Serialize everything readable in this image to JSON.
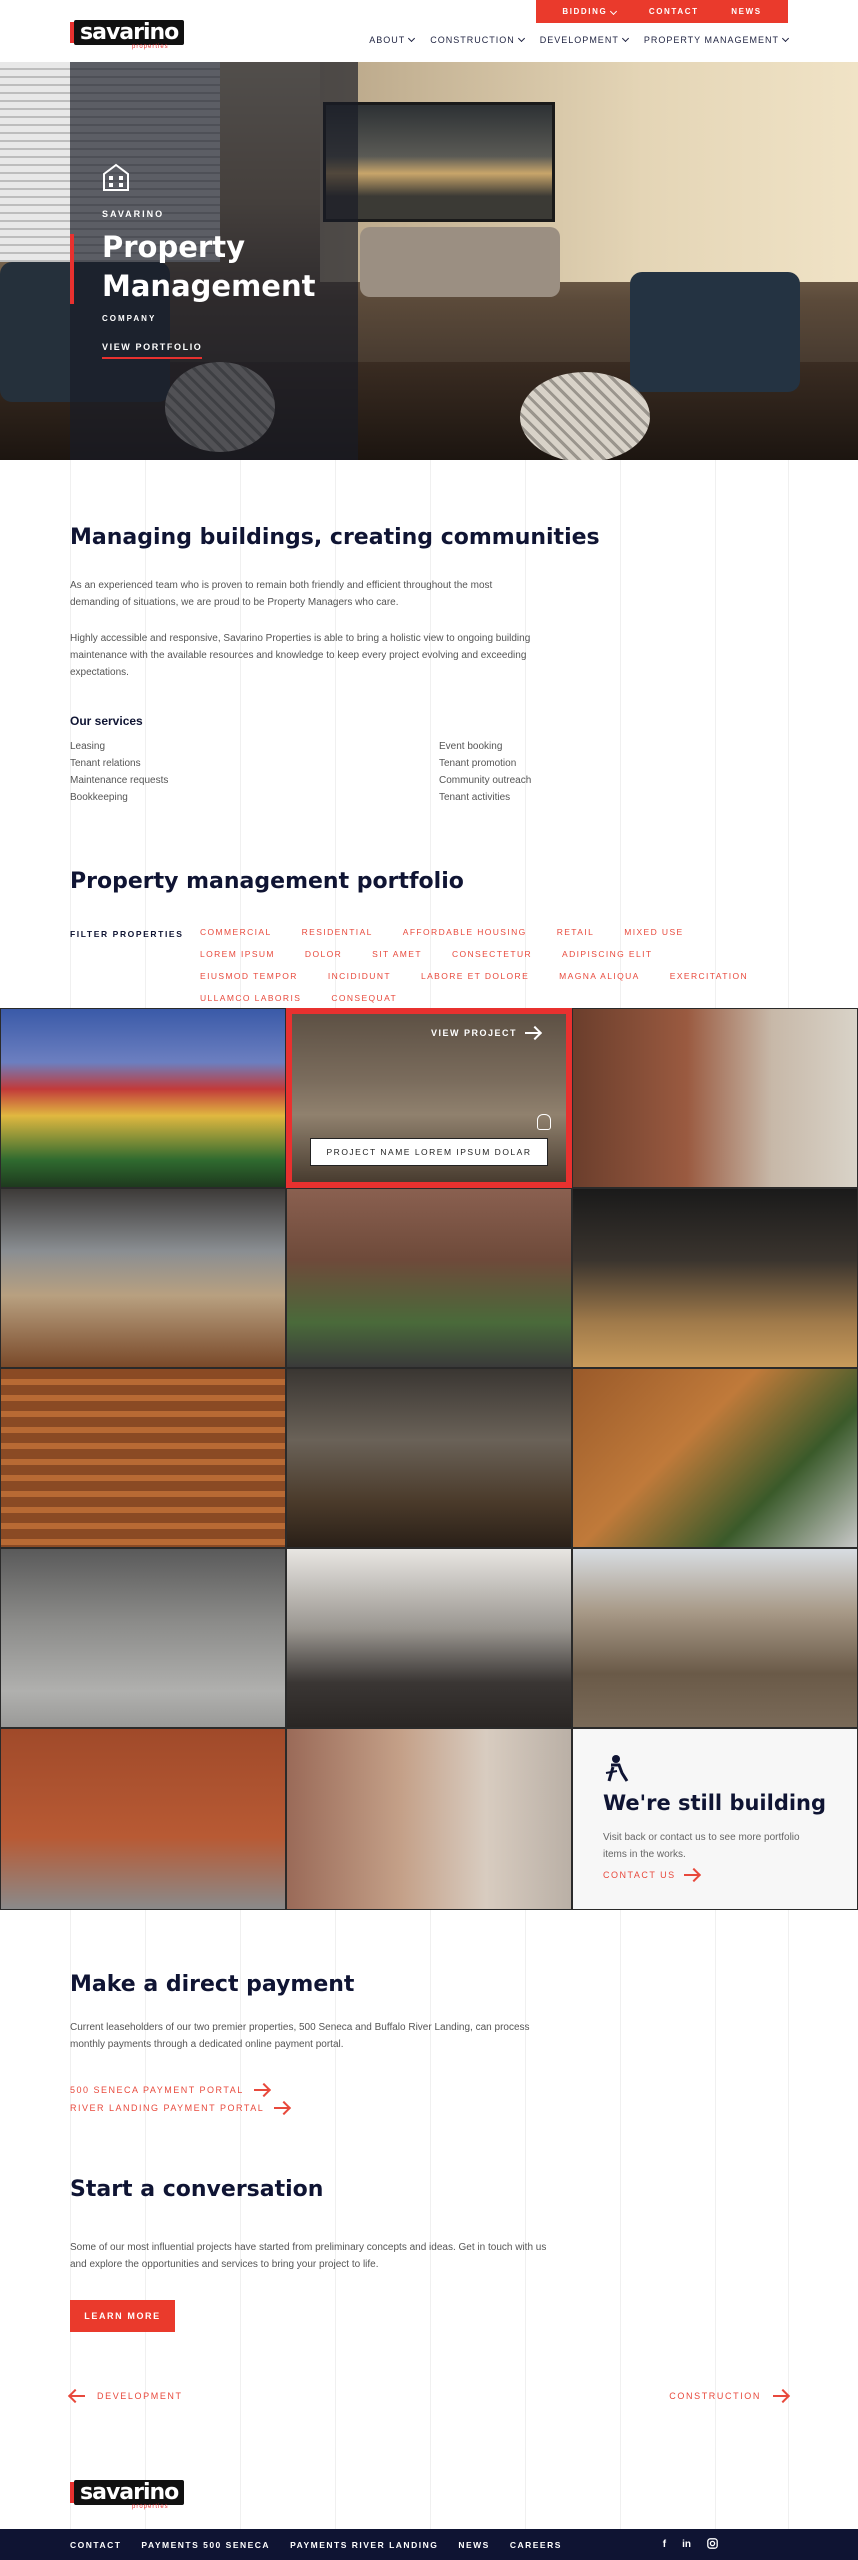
{
  "colors": {
    "accent": "#e8312f",
    "navy": "#0f1433",
    "text_gray": "#555555"
  },
  "brand": {
    "name": "savarino",
    "tagline": "properties"
  },
  "topbar": [
    {
      "label": "BIDDING",
      "has_chevron": true
    },
    {
      "label": "CONTACT"
    },
    {
      "label": "NEWS"
    }
  ],
  "nav": [
    {
      "label": "ABOUT"
    },
    {
      "label": "CONSTRUCTION"
    },
    {
      "label": "DEVELOPMENT"
    },
    {
      "label": "PROPERTY MANAGEMENT"
    }
  ],
  "hero": {
    "icon": "building-icon",
    "eyebrow": "SAVARINO",
    "title_line1": "Property",
    "title_line2": "Management",
    "subtitle": "COMPANY",
    "cta": "VIEW PORTFOLIO"
  },
  "about": {
    "title": "Managing buildings, creating communities",
    "para1": "As an experienced team who is proven to remain both friendly and efficient throughout the most demanding of situations, we are proud to be Property Managers who care.",
    "para2": "Highly accessible and responsive, Savarino Properties is able to bring a holistic view to ongoing building maintenance with the available resources and knowledge to keep every project evolving and exceeding expectations.",
    "services_title": "Our services",
    "services_left": [
      "Leasing",
      "Tenant relations",
      "Maintenance requests",
      "Bookkeeping"
    ],
    "services_right": [
      "Event booking",
      "Tenant promotion",
      "Community outreach",
      "Tenant activities"
    ]
  },
  "portfolio": {
    "title": "Property management portfolio",
    "filter_label": "FILTER PROPERTIES",
    "filters": [
      "COMMERCIAL",
      "RESIDENTIAL",
      "AFFORDABLE HOUSING",
      "RETAIL",
      "MIXED USE",
      "LOREM IPSUM",
      "DOLOR",
      "SIT AMET",
      "CONSECTETUR",
      "ADIPISCING ELIT",
      "EIUSMOD TEMPOR",
      "INCIDIDUNT",
      "LABORE ET DOLORE",
      "MAGNA ALIQUA",
      "EXERCITATION",
      "ULLAMCO LABORIS",
      "CONSEQUAT"
    ],
    "hover": {
      "view": "VIEW PROJECT",
      "name": "PROJECT NAME LOREM IPSUM DOLAR"
    },
    "building": {
      "icon": "worker-icon",
      "title": "We're still building",
      "text": "Visit back or contact us to see more portfolio items in the works.",
      "link": "CONTACT US"
    }
  },
  "payment": {
    "title": "Make a direct payment",
    "text": "Current leaseholders of our two premier properties, 500 Seneca and Buffalo River Landing, can process monthly payments through a dedicated online payment portal.",
    "link1": "500 SENECA PAYMENT PORTAL",
    "link2": "RIVER LANDING PAYMENT PORTAL"
  },
  "conversation": {
    "title": "Start a conversation",
    "text": "Some of our most influential projects have started from preliminary concepts and ideas. Get in touch with us and explore the opportunities and services to bring your project to life.",
    "button": "LEARN MORE"
  },
  "pager": {
    "prev": "DEVELOPMENT",
    "next": "CONSTRUCTION"
  },
  "footer": {
    "links": [
      "CONTACT",
      "PAYMENTS 500 SENECA",
      "PAYMENTS RIVER LANDING",
      "NEWS",
      "CAREERS"
    ],
    "social": [
      "facebook-icon",
      "linkedin-icon",
      "instagram-icon"
    ]
  }
}
